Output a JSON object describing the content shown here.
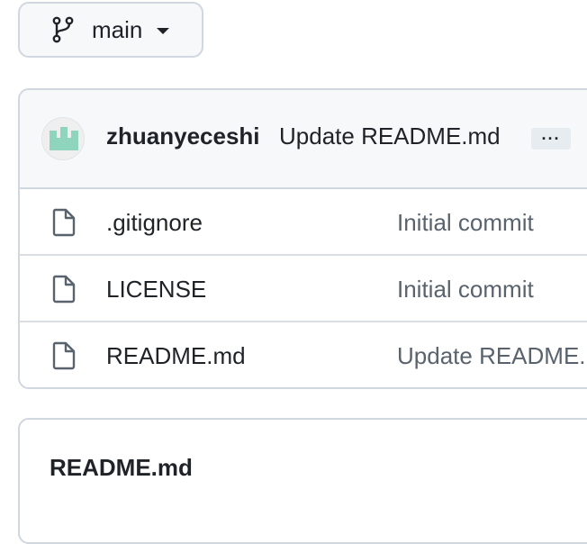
{
  "branch": {
    "name": "main",
    "icon": "git-branch-icon",
    "caret_icon": "triangle-down-icon"
  },
  "latest_commit": {
    "author": "zhuanyeceshi",
    "message": "Update README.md",
    "more_label": "···",
    "avatar_color": "#8fd5bd"
  },
  "files": [
    {
      "name": ".gitignore",
      "commit_message": "Initial commit",
      "icon": "file-icon"
    },
    {
      "name": "LICENSE",
      "commit_message": "Initial commit",
      "icon": "file-icon"
    },
    {
      "name": "README.md",
      "commit_message": "Update README.md",
      "icon": "file-icon"
    }
  ],
  "readme": {
    "title": "README.md"
  },
  "colors": {
    "border": "#d0d7de",
    "header_bg": "#f6f8fa",
    "text": "#1f2328",
    "muted_text": "#59636e"
  }
}
